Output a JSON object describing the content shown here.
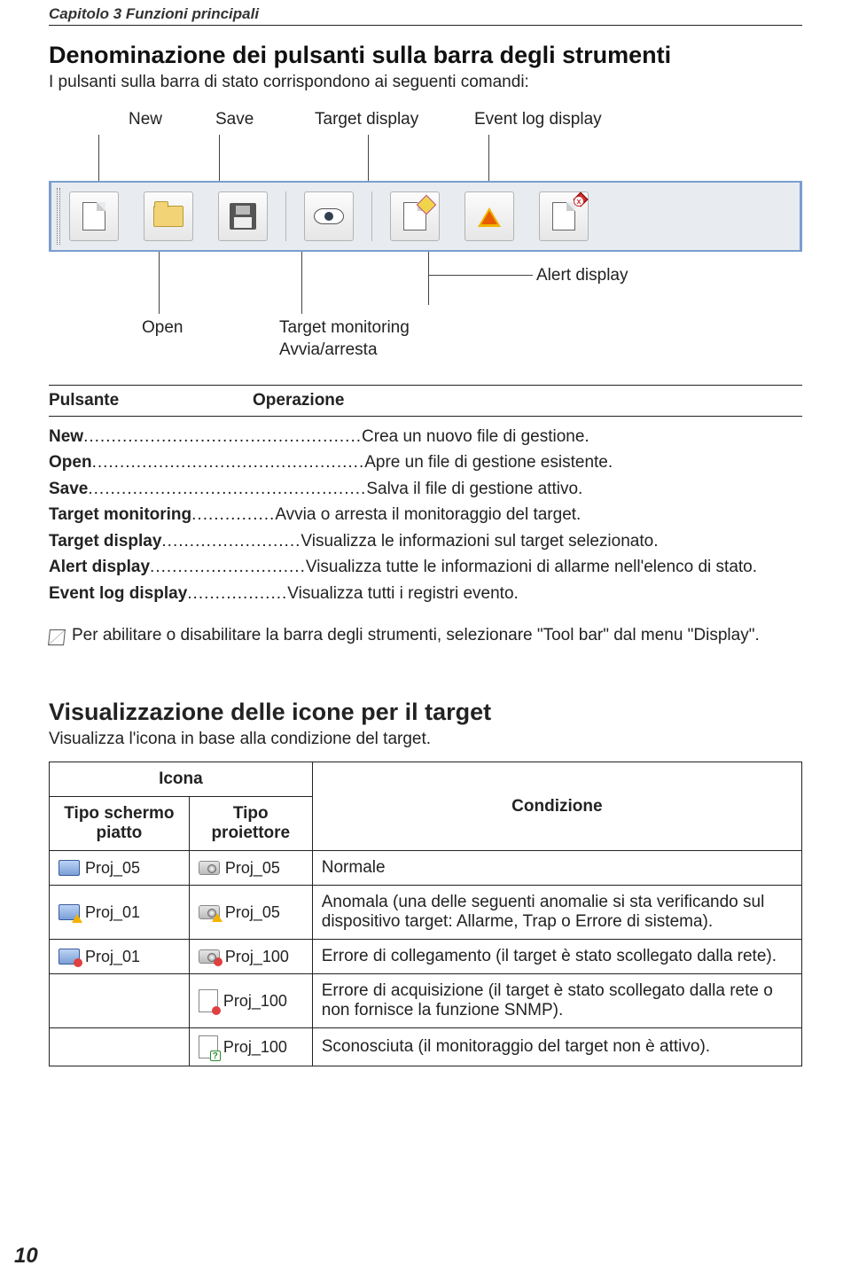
{
  "chapter_header": "Capitolo 3  Funzioni principali",
  "section1": {
    "title": "Denominazione dei pulsanti sulla barra degli strumenti",
    "sub": "I pulsanti sulla barra di stato corrispondono ai seguenti comandi:"
  },
  "callouts": {
    "top": {
      "new": "New",
      "save": "Save",
      "target_display": "Target display",
      "event_log_display": "Event log display"
    },
    "bottom": {
      "open": "Open",
      "target_monitoring": "Target monitoring",
      "avvia_arresta": "Avvia/arresta",
      "alert_display": "Alert display"
    }
  },
  "op_table": {
    "head_l": "Pulsante",
    "head_r": "Operazione",
    "rows": [
      {
        "name": "New",
        "dots": "..................................................",
        "desc": "Crea un nuovo file di gestione."
      },
      {
        "name": "Open",
        "dots": ".................................................",
        "desc": "Apre un file di gestione esistente."
      },
      {
        "name": "Save",
        "dots": "..................................................",
        "desc": "Salva il file di gestione attivo."
      },
      {
        "name": "Target monitoring",
        "dots": "...............",
        "desc": "Avvia o arresta il monitoraggio del target."
      },
      {
        "name": "Target display",
        "dots": ".........................",
        "desc": "Visualizza le informazioni sul target selezionato."
      },
      {
        "name": "Alert display",
        "dots": "............................",
        "desc": "Visualizza tutte le informazioni di allarme nell'elenco di stato."
      },
      {
        "name": "Event log display",
        "dots": "..................",
        "desc": "Visualizza tutti i registri evento."
      }
    ]
  },
  "note": "Per abilitare o disabilitare la barra degli strumenti, selezionare \"Tool bar\" dal menu \"Display\".",
  "section2": {
    "title": "Visualizzazione delle icone per il target",
    "sub": "Visualizza l'icona in base alla condizione del target."
  },
  "icon_table": {
    "head_icona": "Icona",
    "head_piatto": "Tipo schermo piatto",
    "head_proj": "Tipo proiettore",
    "head_cond": "Condizione",
    "rows": [
      {
        "piatto": "Proj_05",
        "proj": "Proj_05",
        "cond": "Normale"
      },
      {
        "piatto": "Proj_01",
        "proj": "Proj_05",
        "cond": "Anomala (una delle seguenti anomalie si sta verificando sul dispositivo target: Allarme, Trap o Errore di sistema)."
      },
      {
        "piatto": "Proj_01",
        "proj": "Proj_100",
        "cond": "Errore di collegamento (il target è stato scollegato dalla rete)."
      },
      {
        "piatto": "",
        "proj": "Proj_100",
        "cond": "Errore di acquisizione (il target è stato scollegato dalla rete o non fornisce la funzione SNMP)."
      },
      {
        "piatto": "",
        "proj": "Proj_100",
        "cond": "Sconosciuta (il monitoraggio del target non è attivo)."
      }
    ]
  },
  "page_number": "10"
}
